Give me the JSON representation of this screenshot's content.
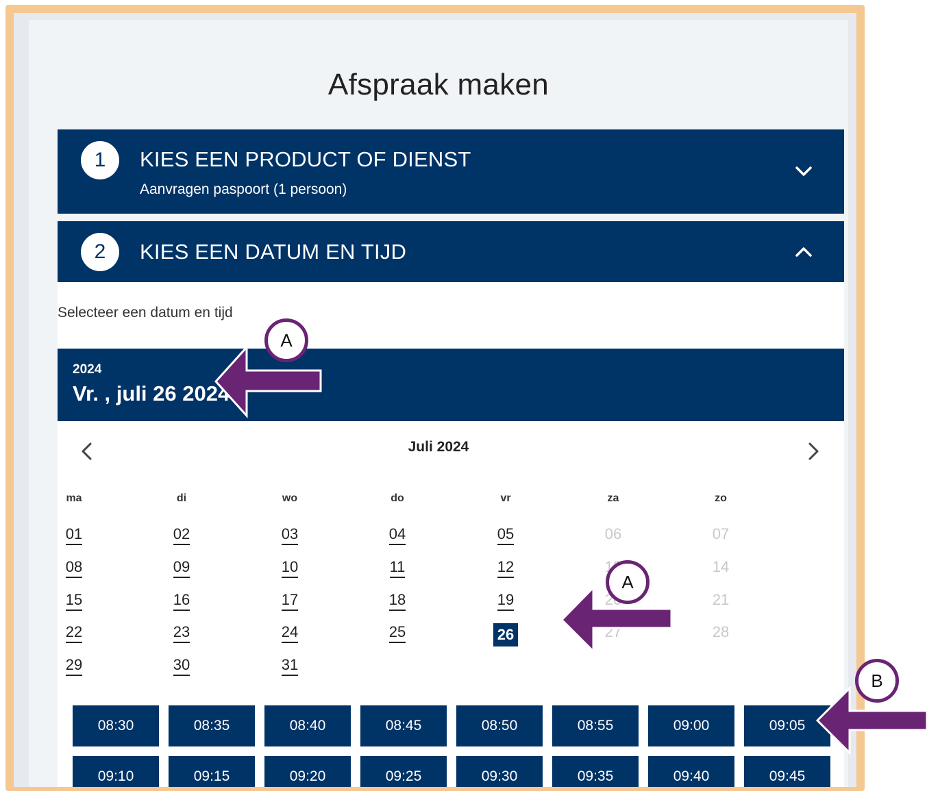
{
  "page": {
    "title": "Afspraak maken"
  },
  "step1": {
    "number": "1",
    "title": "KIES EEN PRODUCT OF DIENST",
    "subtitle": "Aanvragen paspoort (1 persoon)"
  },
  "step2": {
    "number": "2",
    "title": "KIES EEN DATUM EN TIJD"
  },
  "instruction": "Selecteer een datum en tijd",
  "datebar": {
    "year": "2024",
    "selected_date": "Vr. , juli 26 2024"
  },
  "calendar": {
    "month_label": "Juli 2024",
    "weekdays": [
      "ma",
      "di",
      "wo",
      "do",
      "vr",
      "za",
      "zo"
    ],
    "weeks": [
      [
        "01",
        "02",
        "03",
        "04",
        "05",
        "06",
        "07"
      ],
      [
        "08",
        "09",
        "10",
        "11",
        "12",
        "13",
        "14"
      ],
      [
        "15",
        "16",
        "17",
        "18",
        "19",
        "20",
        "21"
      ],
      [
        "22",
        "23",
        "24",
        "25",
        "26",
        "27",
        "28"
      ],
      [
        "29",
        "30",
        "31"
      ]
    ],
    "selected_day": "26"
  },
  "times": {
    "row1": [
      "08:30",
      "08:35",
      "08:40",
      "08:45",
      "08:50",
      "08:55",
      "09:00",
      "09:05"
    ],
    "row2": [
      "09:10",
      "09:15",
      "09:20",
      "09:25",
      "09:30",
      "09:35",
      "09:40",
      "09:45"
    ]
  },
  "annotations": {
    "a": "A",
    "b": "B"
  },
  "colors": {
    "primary": "#003366",
    "annotation": "#6a2474",
    "frame": "#f5c892"
  }
}
